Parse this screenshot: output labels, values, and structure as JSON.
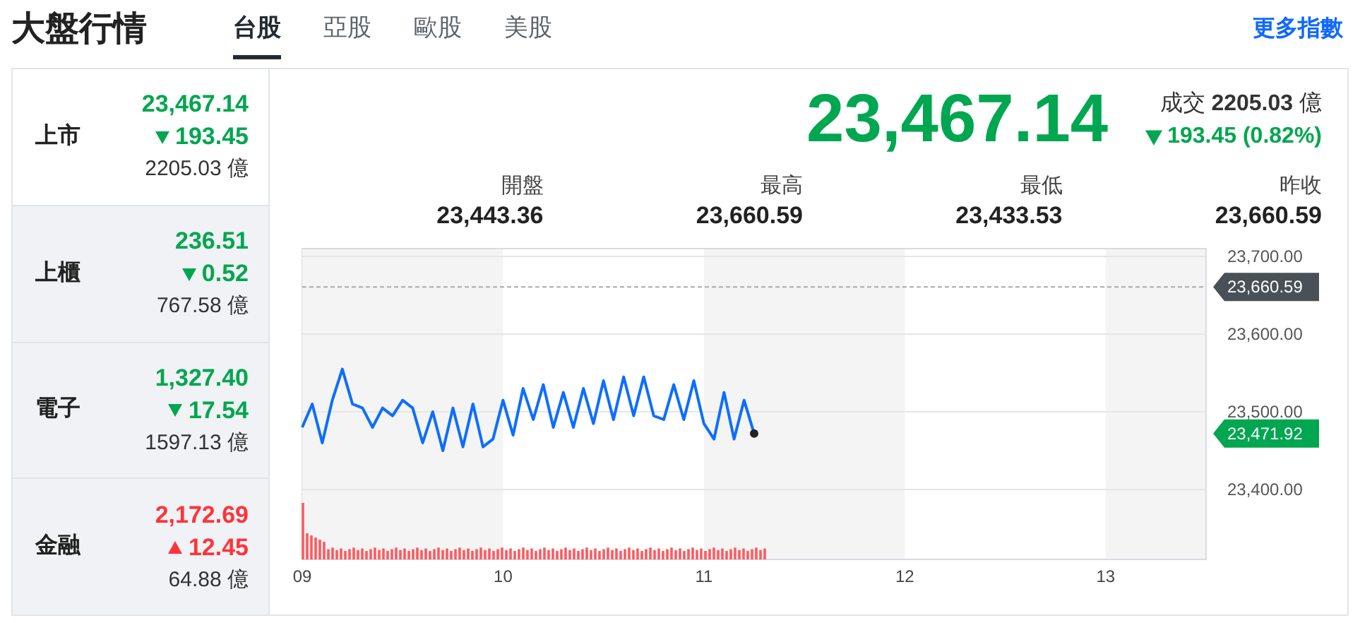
{
  "header": {
    "title": "大盤行情",
    "more_link": "更多指數"
  },
  "tabs": [
    {
      "label": "台股",
      "selected": true
    },
    {
      "label": "亞股",
      "selected": false
    },
    {
      "label": "歐股",
      "selected": false
    },
    {
      "label": "美股",
      "selected": false
    }
  ],
  "markets": [
    {
      "name": "上市",
      "price": "23,467.14",
      "change": "193.45",
      "kind": "down",
      "volume": "2205.03 億",
      "selected": true
    },
    {
      "name": "上櫃",
      "price": "236.51",
      "change": "0.52",
      "kind": "down",
      "volume": "767.58 億",
      "selected": false
    },
    {
      "name": "電子",
      "price": "1,327.40",
      "change": "17.54",
      "kind": "down",
      "volume": "1597.13 億",
      "selected": false
    },
    {
      "name": "金融",
      "price": "2,172.69",
      "change": "12.45",
      "kind": "up",
      "volume": "64.88 億",
      "selected": false
    }
  ],
  "quote": {
    "price": "23,467.14",
    "kind": "down",
    "turnover": "成交 **2205.03** 億",
    "change": "193.45 (0.82%)"
  },
  "stats": [
    {
      "label": "開盤",
      "value": "23,443.36"
    },
    {
      "label": "最高",
      "value": "23,660.59"
    },
    {
      "label": "最低",
      "value": "23,433.53"
    },
    {
      "label": "昨收",
      "value": "23,660.59"
    }
  ],
  "chart_data": {
    "type": "line",
    "xlim": [
      9,
      13.5
    ],
    "ylim": [
      23310,
      23710
    ],
    "grid": true,
    "xticks": [
      {
        "value": 9,
        "label": "09"
      },
      {
        "value": 10,
        "label": "10"
      },
      {
        "value": 11,
        "label": "11"
      },
      {
        "value": 12,
        "label": "12"
      },
      {
        "value": 13,
        "label": "13"
      }
    ],
    "yticks": [
      {
        "value": 23400,
        "label": "23,400.00"
      },
      {
        "value": 23500,
        "label": "23,500.00"
      },
      {
        "value": 23600,
        "label": "23,600.00"
      },
      {
        "value": 23700,
        "label": "23,700.00"
      }
    ],
    "x": [
      9,
      9.05,
      9.1,
      9.15,
      9.2,
      9.25,
      9.3,
      9.35,
      9.4,
      9.45,
      9.5,
      9.55,
      9.6,
      9.65,
      9.7,
      9.75,
      9.8,
      9.85,
      9.9,
      9.95,
      10,
      10.05,
      10.1,
      10.15,
      10.2,
      10.25,
      10.3,
      10.35,
      10.4,
      10.45,
      10.5,
      10.55,
      10.6,
      10.65,
      10.7,
      10.75,
      10.8,
      10.85,
      10.9,
      10.95,
      11,
      11.05,
      11.1,
      11.15,
      11.2,
      11.25
    ],
    "series": [
      {
        "color": "#0d6efd",
        "values": [
          23480,
          23510,
          23460,
          23515,
          23555,
          23510,
          23505,
          23480,
          23505,
          23495,
          23515,
          23505,
          23460,
          23500,
          23450,
          23505,
          23455,
          23510,
          23455,
          23465,
          23515,
          23470,
          23530,
          23490,
          23535,
          23480,
          23525,
          23480,
          23530,
          23485,
          23540,
          23490,
          23545,
          23495,
          23545,
          23495,
          23490,
          23535,
          23490,
          23540,
          23485,
          23465,
          23525,
          23465,
          23515,
          23472
        ]
      }
    ],
    "ref_lines": [
      {
        "axis": "y",
        "value": 23660.59,
        "label": "23,660.59"
      }
    ],
    "annotations": [
      "23,471.92"
    ]
  }
}
